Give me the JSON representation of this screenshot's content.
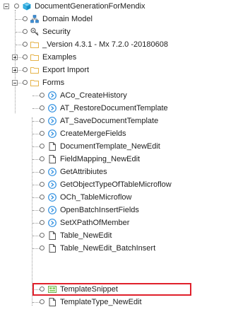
{
  "tree": {
    "root": {
      "label": "DocumentGenerationForMendix",
      "icon": "module-icon"
    },
    "items": [
      {
        "label": "Domain Model",
        "icon": "domain-model-icon"
      },
      {
        "label": "Security",
        "icon": "security-key-icon"
      },
      {
        "label": "_Version 4.3.1 - Mx 7.2.0 -20180608",
        "icon": "folder-icon"
      },
      {
        "label": "Examples",
        "icon": "folder-icon",
        "expander": "+"
      },
      {
        "label": "Export Import",
        "icon": "folder-icon",
        "expander": "+"
      },
      {
        "label": "Forms",
        "icon": "folder-icon",
        "expander": "-"
      }
    ],
    "forms_children": [
      {
        "label": "ACo_CreateHistory",
        "icon": "microflow-icon"
      },
      {
        "label": "AT_RestoreDocumentTemplate",
        "icon": "microflow-icon"
      },
      {
        "label": "AT_SaveDocumentTemplate",
        "icon": "microflow-icon"
      },
      {
        "label": "CreateMergeFields",
        "icon": "microflow-icon"
      },
      {
        "label": "DocumentTemplate_NewEdit",
        "icon": "page-icon"
      },
      {
        "label": "FieldMapping_NewEdit",
        "icon": "page-icon"
      },
      {
        "label": "GetAttribiutes",
        "icon": "microflow-icon"
      },
      {
        "label": "GetObjectTypeOfTableMicroflow",
        "icon": "microflow-icon"
      },
      {
        "label": "OCh_TableMicroflow",
        "icon": "microflow-icon"
      },
      {
        "label": "OpenBatchInsertFields",
        "icon": "microflow-icon"
      },
      {
        "label": "SetXPathOfMember",
        "icon": "microflow-icon"
      },
      {
        "label": "Table_NewEdit",
        "icon": "page-icon"
      },
      {
        "label": "Table_NewEdit_BatchInsert",
        "icon": "page-icon"
      },
      {
        "label": "TemplateSnippet",
        "icon": "snippet-icon",
        "highlighted": true
      },
      {
        "label": "TemplateType_NewEdit",
        "icon": "page-icon"
      }
    ]
  },
  "colors": {
    "highlight_border": "#e0202b",
    "microflow": "#2e8fe0",
    "folder": "#e5b34a",
    "module": "#1aa0d8",
    "snippet": "#6aae4a"
  }
}
